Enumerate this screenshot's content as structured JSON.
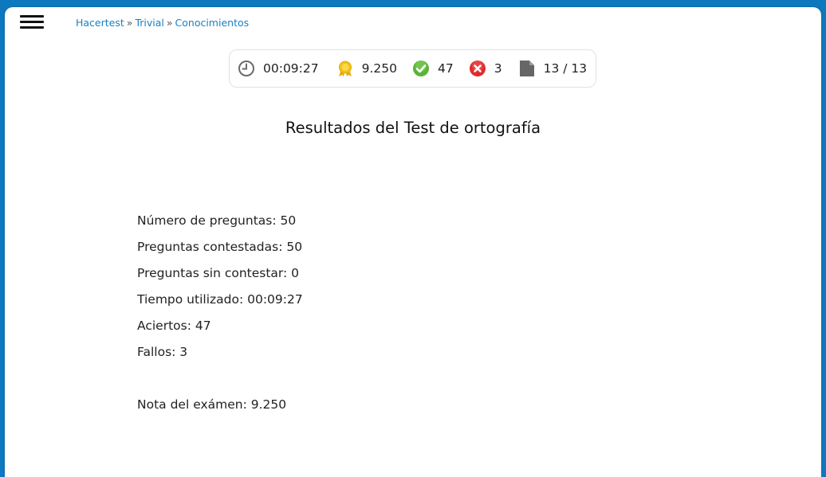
{
  "breadcrumb": {
    "items": [
      "Hacertest",
      "Trivial",
      "Conocimientos"
    ],
    "separator": "»"
  },
  "status": {
    "time": "00:09:27",
    "score": "9.250",
    "correct": "47",
    "wrong": "3",
    "pages": "13 / 13"
  },
  "title": "Resultados del Test de ortografía",
  "results": {
    "num_questions": "Número de preguntas: 50",
    "answered": "Preguntas contestadas: 50",
    "unanswered": "Preguntas sin contestar: 0",
    "time_used": "Tiempo utilizado: 00:09:27",
    "correct": "Aciertos: 47",
    "wrong": "Fallos: 3",
    "grade": "Nota del exámen: 9.250"
  },
  "icons": {
    "menu": "hamburger-menu-icon",
    "time": "clock-icon",
    "score": "medal-icon",
    "correct": "check-circle-icon",
    "wrong": "x-circle-icon",
    "pages": "document-icon"
  },
  "colors": {
    "header": "#0e78bf",
    "link": "#1a7fc4",
    "correct": "#5bb33a",
    "wrong": "#e02b2b",
    "medal": "#f3c21a"
  }
}
